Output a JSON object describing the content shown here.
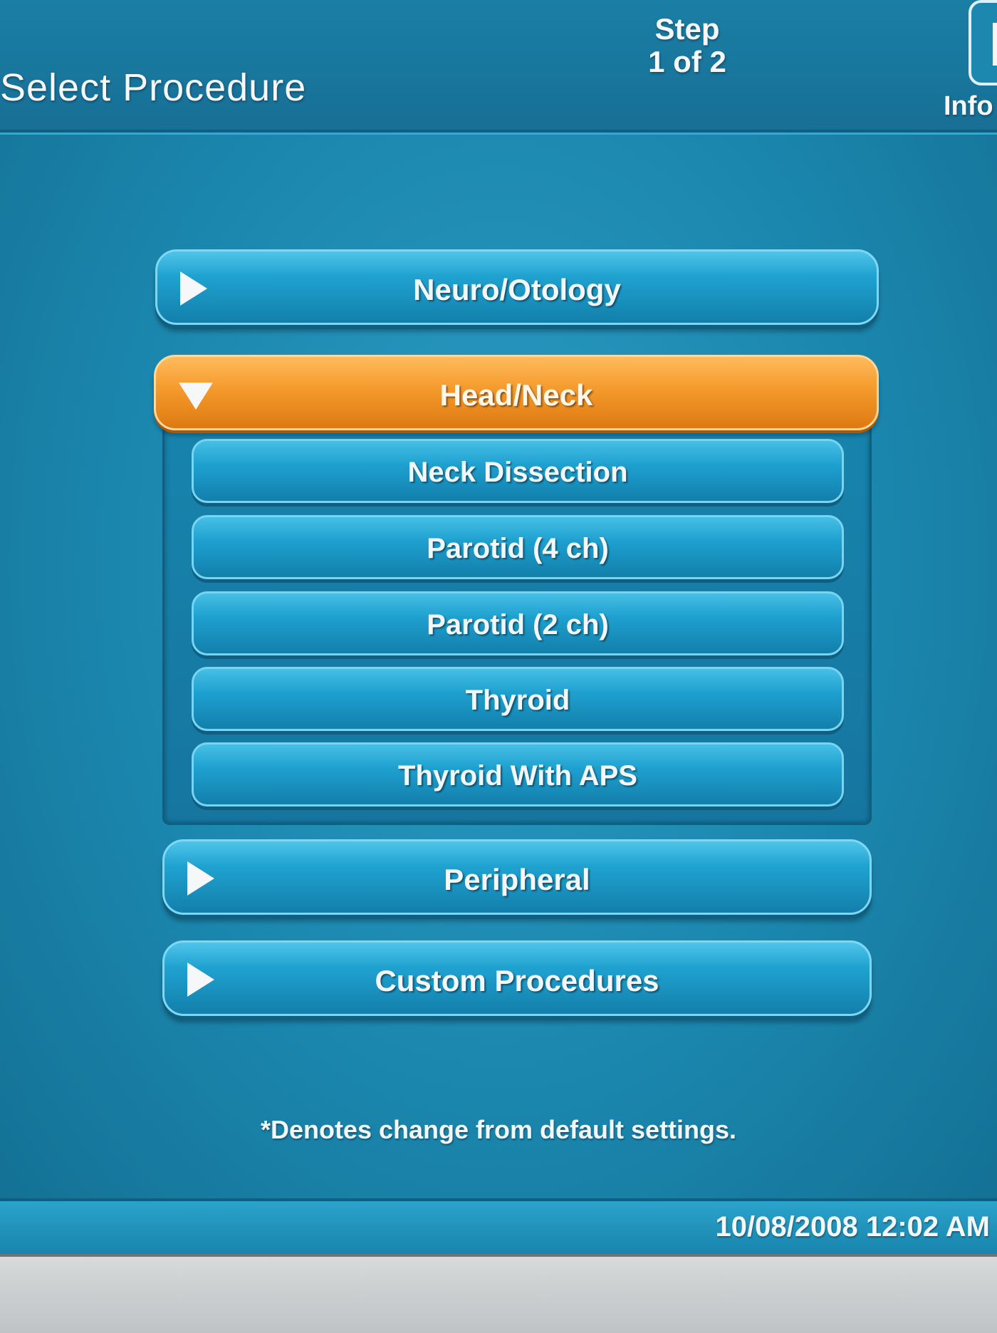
{
  "header": {
    "title": "Select Procedure",
    "step_line1": "Step",
    "step_line2": "1 of 2",
    "info_label": "Info"
  },
  "categories": [
    {
      "label": "Neuro/Otology",
      "expanded": false
    },
    {
      "label": "Head/Neck",
      "expanded": true
    },
    {
      "label": "Peripheral",
      "expanded": false
    },
    {
      "label": "Custom Procedures",
      "expanded": false
    }
  ],
  "head_neck_items": [
    {
      "label": "Neck Dissection"
    },
    {
      "label": "Parotid (4 ch)"
    },
    {
      "label": "Parotid (2 ch)"
    },
    {
      "label": "Thyroid"
    },
    {
      "label": "Thyroid With APS"
    }
  ],
  "footnote": "*Denotes change from default settings.",
  "status": {
    "datetime": "10/08/2008 12:02 AM"
  },
  "colors": {
    "accent_active": "#f59a2c",
    "button_blue": "#1fa2d0",
    "background": "#1b86ad"
  }
}
